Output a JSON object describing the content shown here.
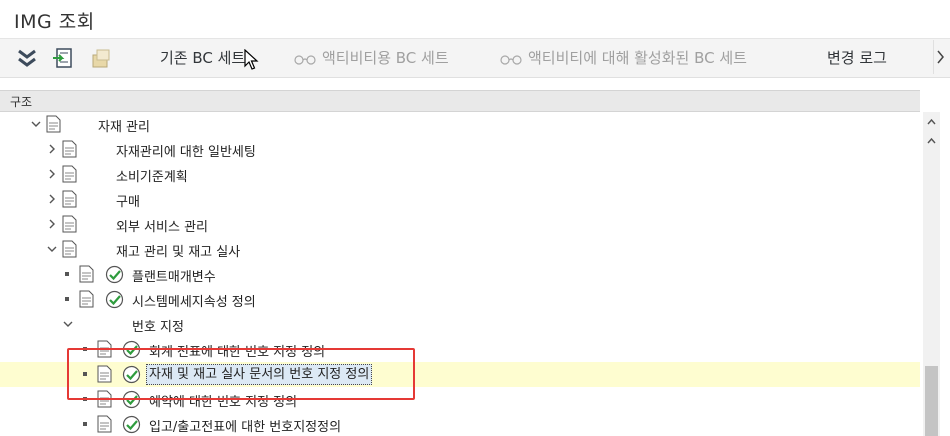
{
  "window": {
    "title": "IMG 조회"
  },
  "toolbar": {
    "icons": [
      "collapse-all-icon",
      "execute-icon",
      "documentation-icon"
    ],
    "buttons": [
      {
        "label": "기존 BC 세트",
        "enabled": true
      },
      {
        "label": "액티비티용 BC 세트",
        "enabled": false
      },
      {
        "label": "액티비티에 대해 활성화된 BC 세트",
        "enabled": false
      },
      {
        "label": "변경 로그",
        "enabled": true
      }
    ]
  },
  "tree": {
    "header": "구조",
    "rows": [
      {
        "label": "자재 관리",
        "expanded": true
      },
      {
        "label": "자재관리에 대한 일반세팅",
        "expanded": false
      },
      {
        "label": "소비기준계획",
        "expanded": false
      },
      {
        "label": "구매",
        "expanded": false
      },
      {
        "label": "외부 서비스 관리",
        "expanded": false
      },
      {
        "label": "재고 관리 및 재고 실사",
        "expanded": true
      },
      {
        "label": "플랜트매개변수"
      },
      {
        "label": "시스템메세지속성 정의"
      },
      {
        "label": "번호 지정",
        "expanded": true
      },
      {
        "label": "회계 전표에 대한 번호 지정 정의"
      },
      {
        "label": "자재 및 재고 실사 문서의 번호 지정 정의",
        "selected": true
      },
      {
        "label": "예약에 대한 번호 지정 정의"
      },
      {
        "label": "입고/출고전표에 대한 번호지정정의"
      }
    ]
  },
  "colors": {
    "selected_row": "#fefdd0",
    "highlight_box": "#e53935",
    "exec_icon": "#2e9c3d"
  }
}
